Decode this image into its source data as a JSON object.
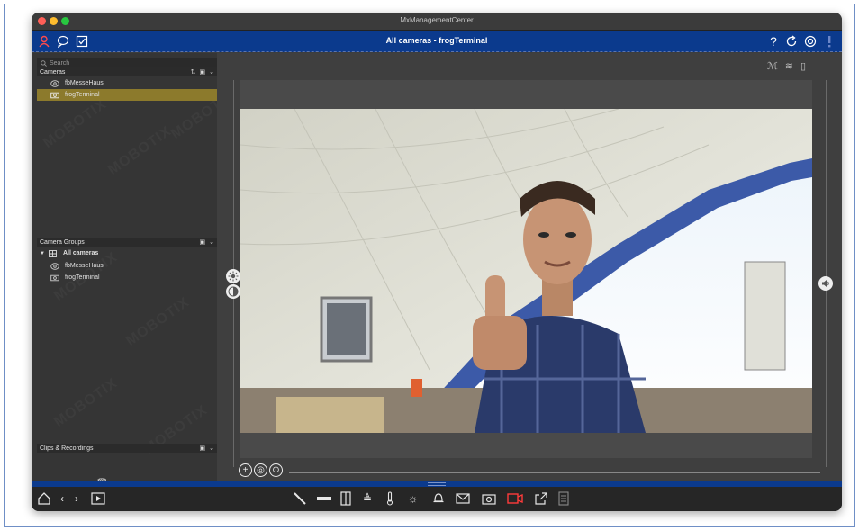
{
  "window": {
    "title": "MxManagementCenter"
  },
  "header": {
    "title": "All cameras - frogTerminal"
  },
  "sidebar": {
    "search_placeholder": "Search",
    "cameras_label": "Cameras",
    "cameras": [
      {
        "label": "fbMesseHaus",
        "selected": false
      },
      {
        "label": "frogTerminal",
        "selected": true
      }
    ],
    "groups_label": "Camera Groups",
    "group_root": "All cameras",
    "group_items": [
      "fbMesseHaus",
      "frogTerminal"
    ],
    "clips_label": "Clips & Recordings",
    "watermark": "MOBOTIX"
  },
  "colors": {
    "accent_blue": "#0b3a8d",
    "selection": "#8c7a2c",
    "panel": "#353535"
  },
  "icons": {
    "header_left": [
      "user-alert-icon",
      "chat-icon",
      "checklist-icon"
    ],
    "header_right": [
      "help-icon",
      "refresh-icon",
      "settings-icon",
      "alert-icon"
    ],
    "bottom": [
      "home-icon",
      "back-icon",
      "forward-icon",
      "playback-icon",
      "ptz-icon",
      "bar-icon",
      "door-icon",
      "light-icon",
      "thermometer-icon",
      "lamp-icon",
      "bell-icon",
      "mail-icon",
      "snapshot-icon",
      "record-icon",
      "export-icon",
      "notes-icon"
    ]
  }
}
